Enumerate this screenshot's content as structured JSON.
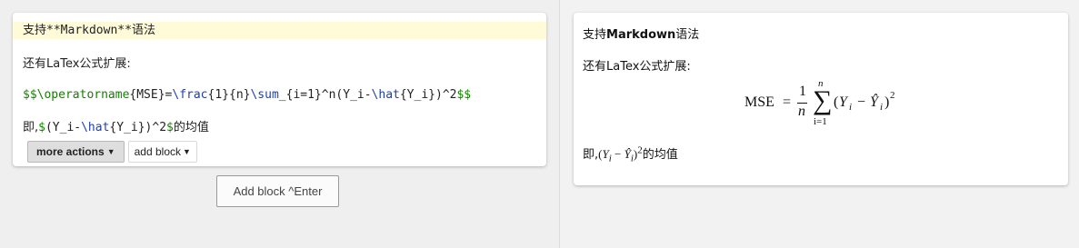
{
  "editor": {
    "line1_prefix": "支持",
    "line1_md": "**Markdown**",
    "line1_suffix": "语法",
    "line2": "还有LaTex公式扩展:",
    "line3": {
      "d1": "$$",
      "op": "\\operatorname",
      "t1": "{MSE}=",
      "frac": "\\frac",
      "t2": "{1}{n}",
      "sum": "\\sum",
      "t3": "_{i=1}^n(Y_i-",
      "hat": "\\hat",
      "t4": "{Y_i})^2",
      "d2": "$$"
    },
    "line4": {
      "prefix": "即,",
      "d1": "$",
      "t1": "(Y_i-",
      "hat": "\\hat",
      "t2": "{Y_i})^2",
      "d2": "$",
      "suffix": "的均值"
    },
    "more_actions_label": "more actions",
    "add_block_label": "add block"
  },
  "add_block_button_label": "Add block ^Enter",
  "preview": {
    "line1_prefix": "支持",
    "line1_bold": "Markdown",
    "line1_suffix": "语法",
    "line2": "还有LaTex公式扩展:",
    "formula": {
      "lhs": "MSE",
      "eq": "=",
      "num": "1",
      "den": "n",
      "sigma": "∑",
      "upper": "n",
      "lower": "i=1",
      "open": "(",
      "y": "Y",
      "sub": "i",
      "minus": "−",
      "yhat": "Ŷ",
      "close": ")",
      "pow": "2"
    },
    "line4": {
      "prefix": "即,",
      "math_open": "(",
      "y": "Y",
      "sub": "i",
      "minus": " − ",
      "yhat": "Ŷ",
      "close": ")",
      "pow": "2",
      "suffix": "的均值"
    }
  },
  "colors": {
    "highlight_line": "#fffbd9",
    "latex_delimiter": "#158000",
    "latex_command": "#1f3fb0"
  }
}
